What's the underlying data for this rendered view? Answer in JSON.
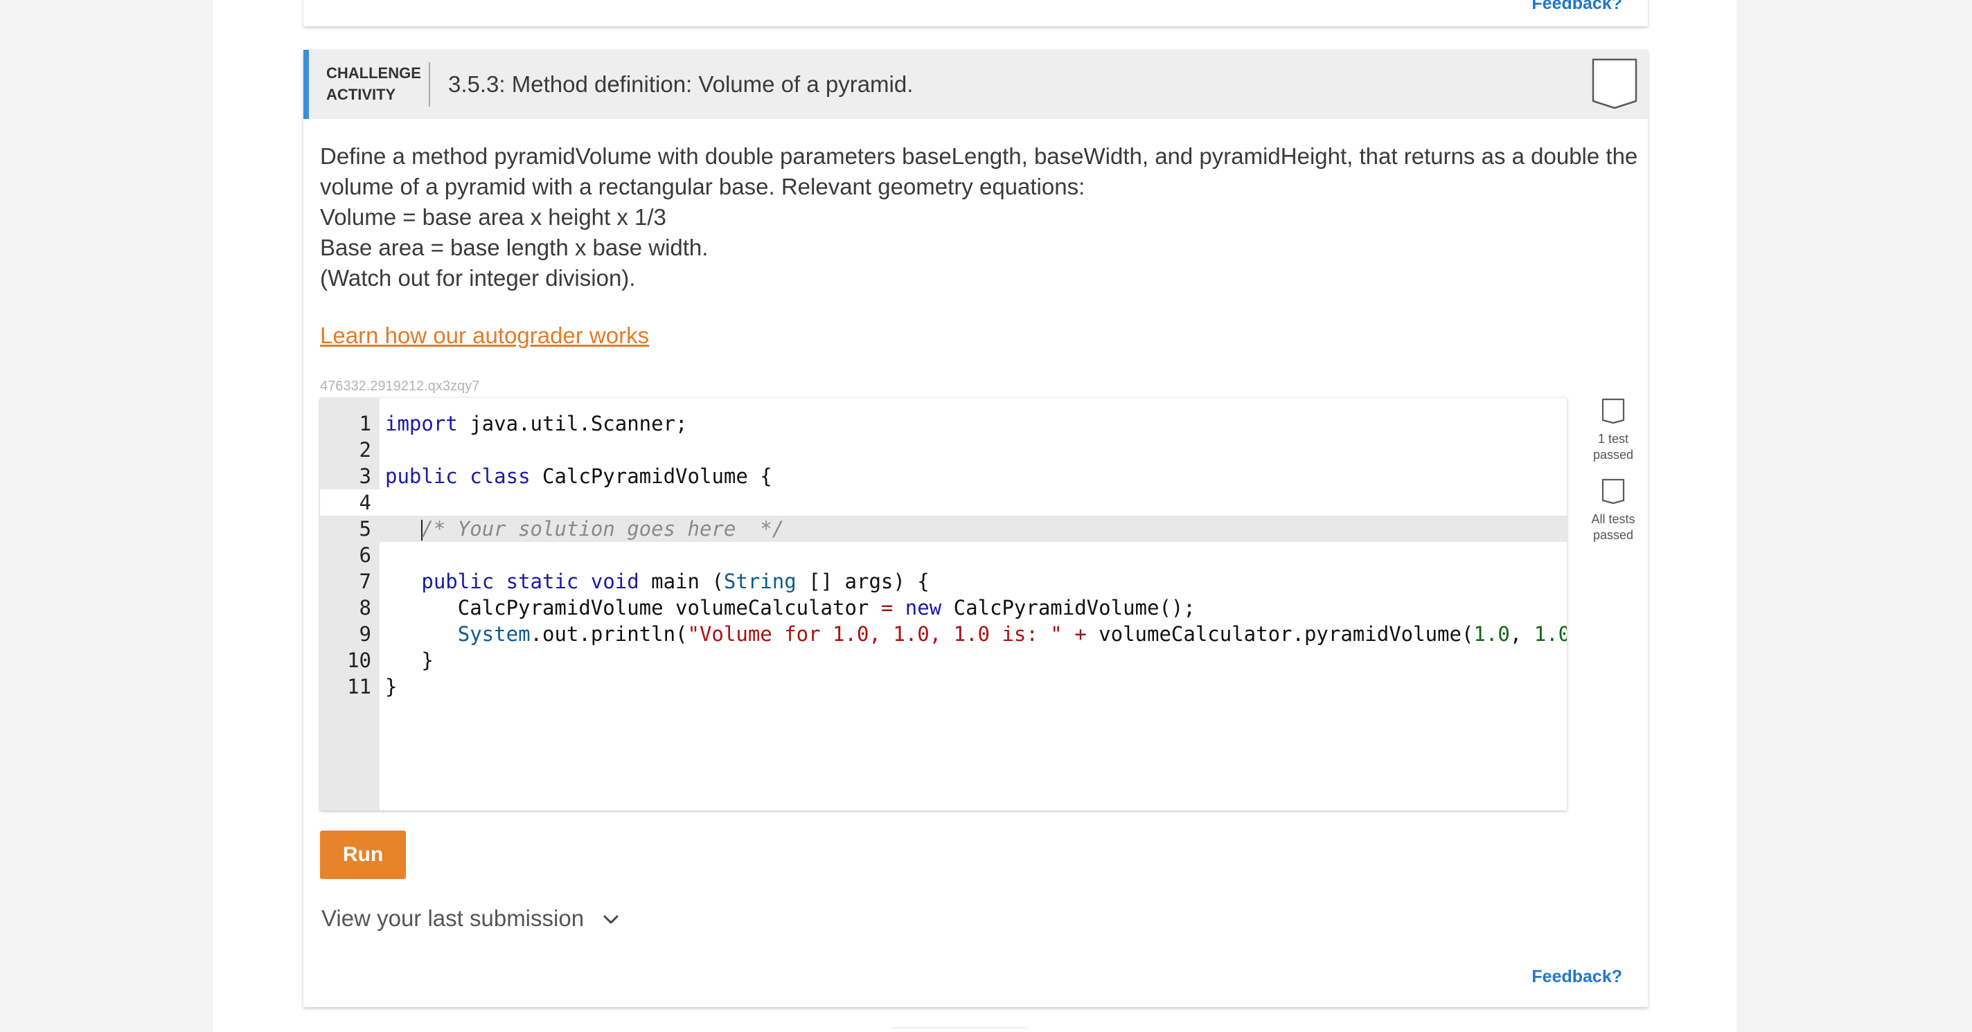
{
  "top_card": {
    "feedback_label": "Feedback?"
  },
  "activity": {
    "type_label": "CHALLENGE ACTIVITY",
    "title": "3.5.3: Method definition: Volume of a pyramid.",
    "prompt_lines": [
      "Define a method pyramidVolume with double parameters baseLength, baseWidth, and pyramidHeight, that returns as a double the",
      "volume of a pyramid with a rectangular base. Relevant geometry equations:",
      "Volume = base area x height x 1/3",
      "Base area = base length x base width.",
      "(Watch out for integer division)."
    ],
    "autograder_link": "Learn how our autograder works",
    "activity_id": "476332.2919212.qx3zqy7"
  },
  "editor": {
    "active_line": 5,
    "lines": [
      {
        "num": "1",
        "text": "import java.util.Scanner;"
      },
      {
        "num": "2",
        "text": ""
      },
      {
        "num": "3",
        "text": "public class CalcPyramidVolume {"
      },
      {
        "num": "4",
        "text": ""
      },
      {
        "num": "5",
        "text": "   /* Your solution goes here  */"
      },
      {
        "num": "6",
        "text": ""
      },
      {
        "num": "7",
        "text": "   public static void main (String [] args) {"
      },
      {
        "num": "8",
        "text": "      CalcPyramidVolume volumeCalculator = new CalcPyramidVolume();"
      },
      {
        "num": "9",
        "text": "      System.out.println(\"Volume for 1.0, 1.0, 1.0 is: \" + volumeCalculator.pyramidVolume(1.0, 1.0, 1."
      },
      {
        "num": "10",
        "text": "   }"
      },
      {
        "num": "11",
        "text": "}"
      }
    ]
  },
  "tests": {
    "first_label": "1 test passed",
    "all_label": "All tests passed"
  },
  "actions": {
    "run_label": "Run",
    "last_submission_label": "View your last submission",
    "feedback_label": "Feedback?"
  },
  "colors": {
    "accent_blue": "#3a8fd8",
    "link_orange": "#e27c28",
    "run_orange": "#e7832b",
    "feedback_blue": "#2278c8"
  },
  "icons": {
    "header_badge": "shield-outline-icon",
    "test_box": "check-shield-outline-icon",
    "submission_toggle": "chevron-down-icon"
  }
}
